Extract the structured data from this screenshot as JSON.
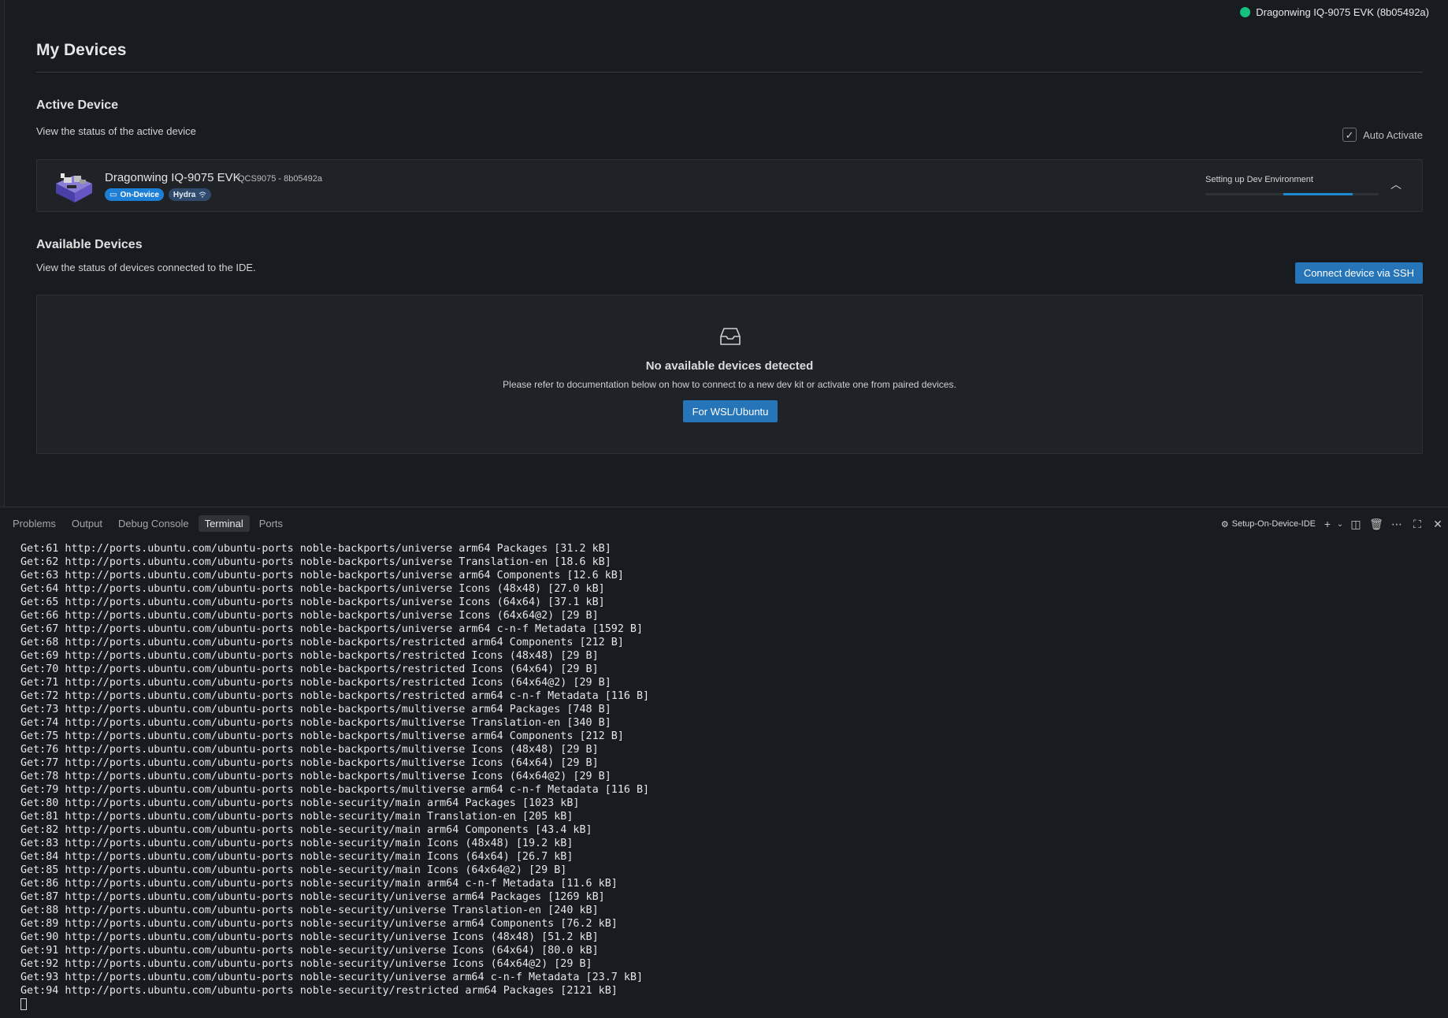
{
  "header": {
    "status_device": "Dragonwing IQ-9075 EVK (8b05492a)",
    "status_color": "#17c27e"
  },
  "page": {
    "title": "My Devices"
  },
  "active": {
    "heading": "Active Device",
    "description": "View the status of the active device",
    "auto_activate_label": "Auto Activate",
    "auto_activate_checked": true,
    "device": {
      "name": "Dragonwing IQ-9075 EVK",
      "model": "QCS9075 - 8b05492a",
      "badges": [
        "On-Device",
        "Hydra"
      ],
      "progress_label": "Setting up Dev Environment",
      "progress_start": 0.45,
      "progress_end": 0.85
    }
  },
  "available": {
    "heading": "Available Devices",
    "description": "View the status of devices connected to the IDE.",
    "ssh_button": "Connect device via SSH",
    "empty_title": "No available devices detected",
    "empty_desc": "Please refer to documentation below on how to connect to a new dev kit or activate one from paired devices.",
    "wsl_button": "For WSL/Ubuntu"
  },
  "panel": {
    "tabs": [
      "Problems",
      "Output",
      "Debug Console",
      "Terminal",
      "Ports"
    ],
    "active_tab": "Terminal",
    "terminal_name": "Setup-On-Device-IDE",
    "icons": [
      "plus-icon",
      "chevron-down-icon",
      "split-icon",
      "trash-icon",
      "more-icon",
      "maximize-icon",
      "close-icon"
    ]
  },
  "terminal": {
    "lines": [
      "Get:61 http://ports.ubuntu.com/ubuntu-ports noble-backports/universe arm64 Packages [31.2 kB]",
      "Get:62 http://ports.ubuntu.com/ubuntu-ports noble-backports/universe Translation-en [18.6 kB]",
      "Get:63 http://ports.ubuntu.com/ubuntu-ports noble-backports/universe arm64 Components [12.6 kB]",
      "Get:64 http://ports.ubuntu.com/ubuntu-ports noble-backports/universe Icons (48x48) [27.0 kB]",
      "Get:65 http://ports.ubuntu.com/ubuntu-ports noble-backports/universe Icons (64x64) [37.1 kB]",
      "Get:66 http://ports.ubuntu.com/ubuntu-ports noble-backports/universe Icons (64x64@2) [29 B]",
      "Get:67 http://ports.ubuntu.com/ubuntu-ports noble-backports/universe arm64 c-n-f Metadata [1592 B]",
      "Get:68 http://ports.ubuntu.com/ubuntu-ports noble-backports/restricted arm64 Components [212 B]",
      "Get:69 http://ports.ubuntu.com/ubuntu-ports noble-backports/restricted Icons (48x48) [29 B]",
      "Get:70 http://ports.ubuntu.com/ubuntu-ports noble-backports/restricted Icons (64x64) [29 B]",
      "Get:71 http://ports.ubuntu.com/ubuntu-ports noble-backports/restricted Icons (64x64@2) [29 B]",
      "Get:72 http://ports.ubuntu.com/ubuntu-ports noble-backports/restricted arm64 c-n-f Metadata [116 B]",
      "Get:73 http://ports.ubuntu.com/ubuntu-ports noble-backports/multiverse arm64 Packages [748 B]",
      "Get:74 http://ports.ubuntu.com/ubuntu-ports noble-backports/multiverse Translation-en [340 B]",
      "Get:75 http://ports.ubuntu.com/ubuntu-ports noble-backports/multiverse arm64 Components [212 B]",
      "Get:76 http://ports.ubuntu.com/ubuntu-ports noble-backports/multiverse Icons (48x48) [29 B]",
      "Get:77 http://ports.ubuntu.com/ubuntu-ports noble-backports/multiverse Icons (64x64) [29 B]",
      "Get:78 http://ports.ubuntu.com/ubuntu-ports noble-backports/multiverse Icons (64x64@2) [29 B]",
      "Get:79 http://ports.ubuntu.com/ubuntu-ports noble-backports/multiverse arm64 c-n-f Metadata [116 B]",
      "Get:80 http://ports.ubuntu.com/ubuntu-ports noble-security/main arm64 Packages [1023 kB]",
      "Get:81 http://ports.ubuntu.com/ubuntu-ports noble-security/main Translation-en [205 kB]",
      "Get:82 http://ports.ubuntu.com/ubuntu-ports noble-security/main arm64 Components [43.4 kB]",
      "Get:83 http://ports.ubuntu.com/ubuntu-ports noble-security/main Icons (48x48) [19.2 kB]",
      "Get:84 http://ports.ubuntu.com/ubuntu-ports noble-security/main Icons (64x64) [26.7 kB]",
      "Get:85 http://ports.ubuntu.com/ubuntu-ports noble-security/main Icons (64x64@2) [29 B]",
      "Get:86 http://ports.ubuntu.com/ubuntu-ports noble-security/main arm64 c-n-f Metadata [11.6 kB]",
      "Get:87 http://ports.ubuntu.com/ubuntu-ports noble-security/universe arm64 Packages [1269 kB]",
      "Get:88 http://ports.ubuntu.com/ubuntu-ports noble-security/universe Translation-en [240 kB]",
      "Get:89 http://ports.ubuntu.com/ubuntu-ports noble-security/universe arm64 Components [76.2 kB]",
      "Get:90 http://ports.ubuntu.com/ubuntu-ports noble-security/universe Icons (48x48) [51.2 kB]",
      "Get:91 http://ports.ubuntu.com/ubuntu-ports noble-security/universe Icons (64x64) [80.0 kB]",
      "Get:92 http://ports.ubuntu.com/ubuntu-ports noble-security/universe Icons (64x64@2) [29 B]",
      "Get:93 http://ports.ubuntu.com/ubuntu-ports noble-security/universe arm64 c-n-f Metadata [23.7 kB]",
      "Get:94 http://ports.ubuntu.com/ubuntu-ports noble-security/restricted arm64 Packages [2121 kB]"
    ]
  },
  "colors": {
    "accent": "#2575b8",
    "badge_blue": "#1d7fd6",
    "progress": "#1f8ad2"
  }
}
